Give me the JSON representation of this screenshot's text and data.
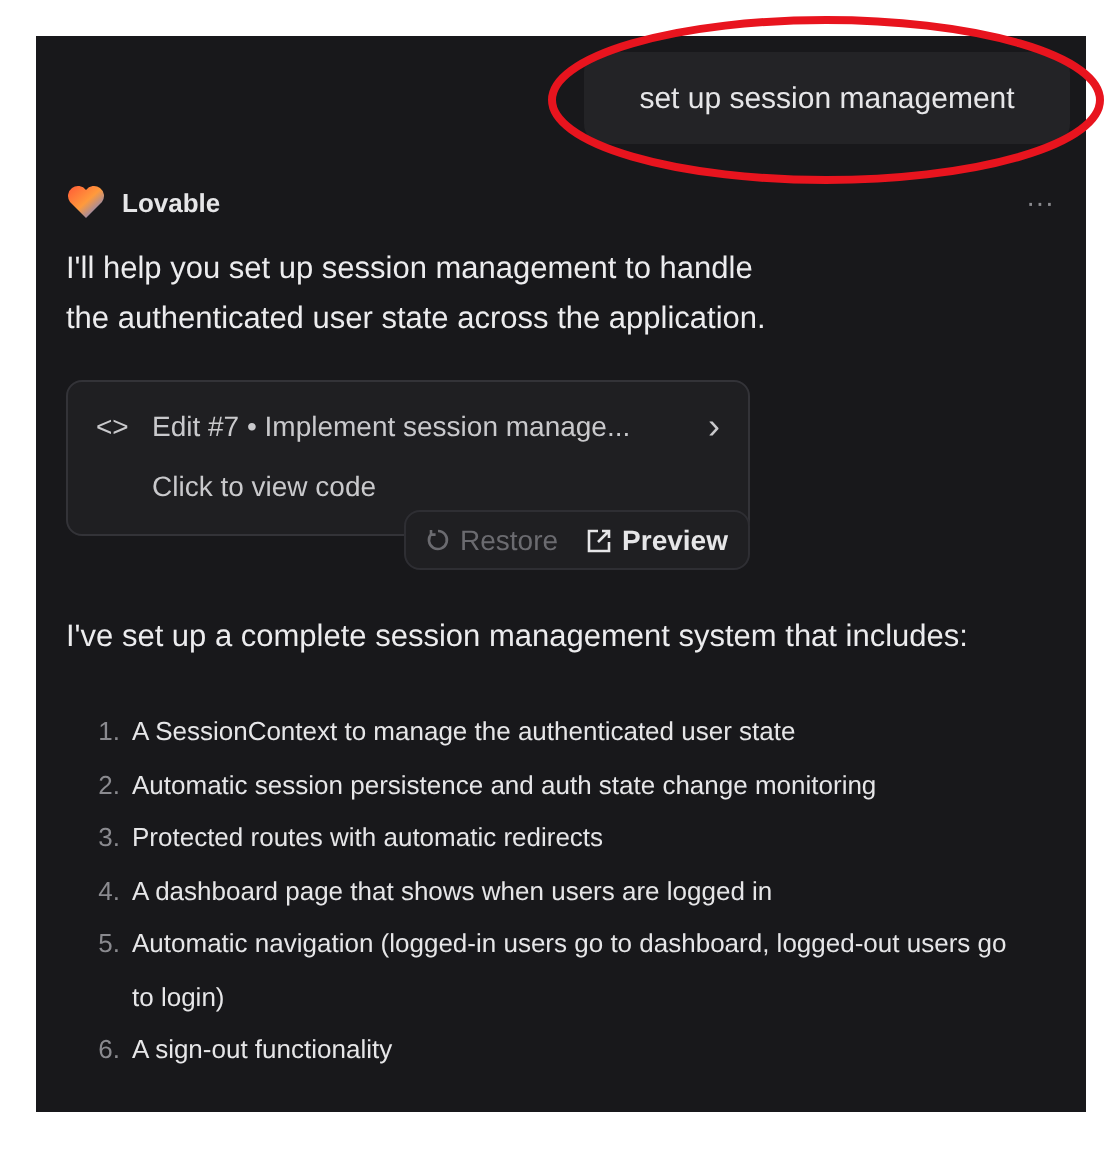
{
  "user_message": "set up session management",
  "assistant": {
    "name": "Lovable",
    "more": "···"
  },
  "intro": "I'll help you set up session management to handle the authenticated user state across the application.",
  "edit_card": {
    "icon": "<>",
    "title": "Edit #7 • Implement session manage...",
    "chevron": "›",
    "subtitle": "Click to view code"
  },
  "actions": [
    {
      "kind": "restore",
      "label": "Restore",
      "disabled": true
    },
    {
      "kind": "preview",
      "label": "Preview",
      "disabled": false
    }
  ],
  "summary": "I've set up a complete session management system that includes:",
  "steps": [
    {
      "number": "1.",
      "text": "A SessionContext to manage the authenticated user state"
    },
    {
      "number": "2.",
      "text": "Automatic session persistence and auth state change monitoring"
    },
    {
      "number": "3.",
      "text": "Protected routes with automatic redirects"
    },
    {
      "number": "4.",
      "text": "A dashboard page that shows when users are logged in"
    },
    {
      "number": "5.",
      "text": "Automatic navigation (logged-in users go to dashboard, logged-out users go to login)"
    },
    {
      "number": "6.",
      "text": "A sign-out functionality"
    }
  ]
}
